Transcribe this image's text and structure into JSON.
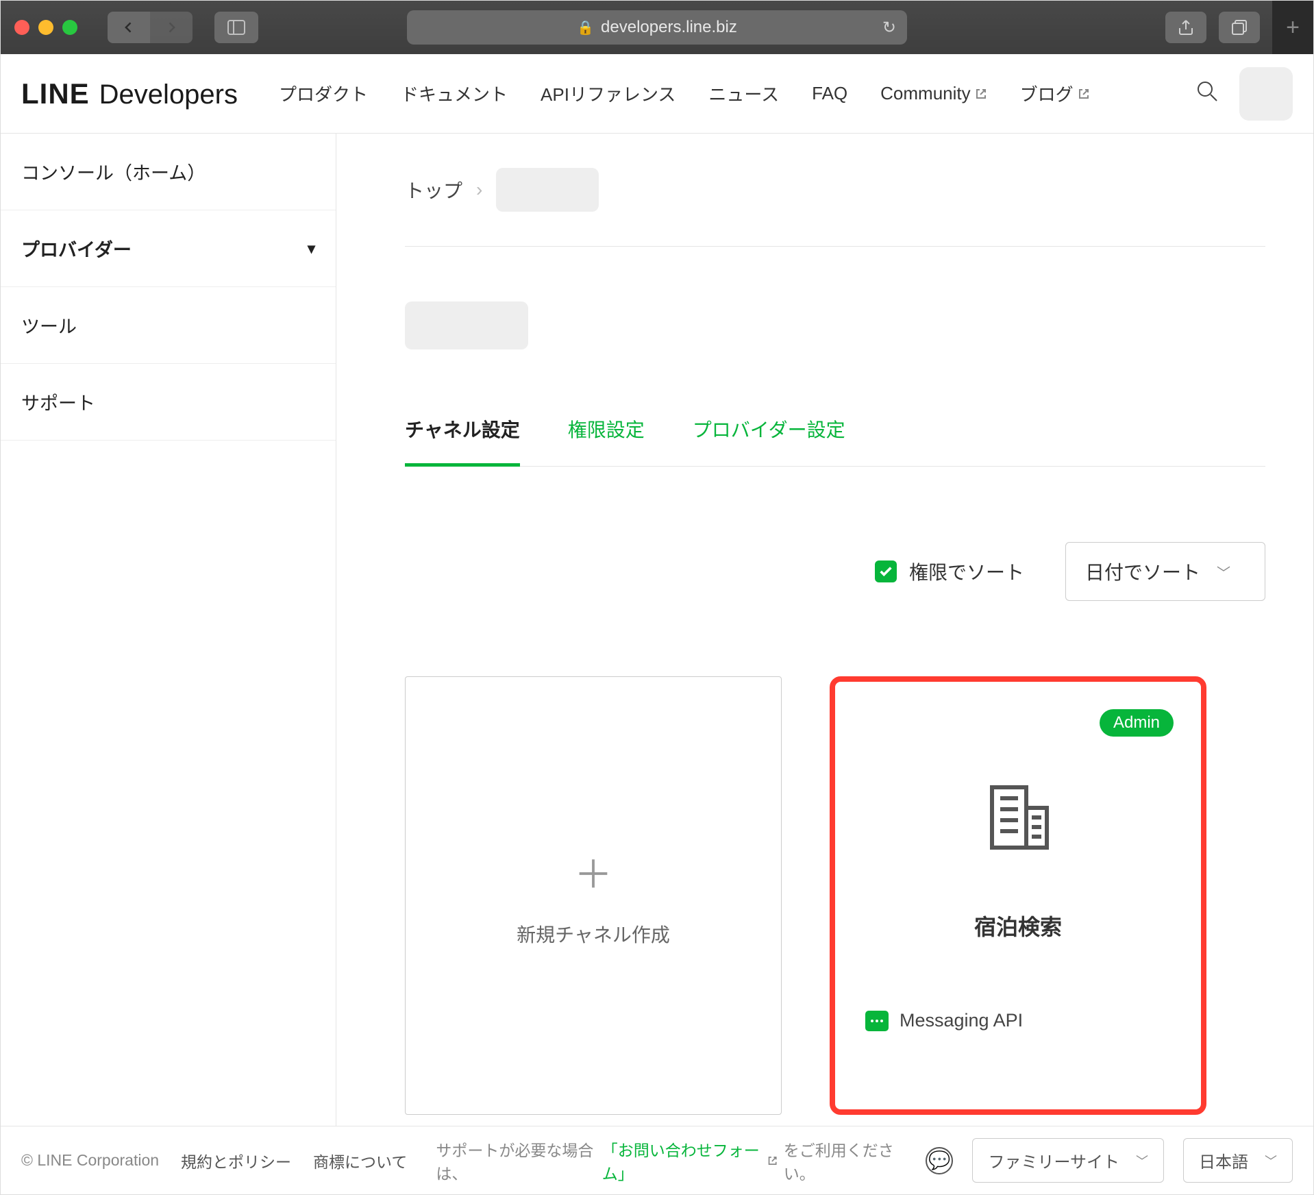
{
  "browser": {
    "url_host": "developers.line.biz"
  },
  "header": {
    "logo_line": "LINE",
    "logo_dev": "Developers",
    "nav": {
      "product": "プロダクト",
      "document": "ドキュメント",
      "api_ref": "APIリファレンス",
      "news": "ニュース",
      "faq": "FAQ",
      "community": "Community",
      "blog": "ブログ"
    }
  },
  "sidebar": {
    "console_home": "コンソール（ホーム）",
    "provider": "プロバイダー",
    "tools": "ツール",
    "support": "サポート"
  },
  "breadcrumb": {
    "top": "トップ"
  },
  "tabs": {
    "channel_settings": "チャネル設定",
    "role_settings": "権限設定",
    "provider_settings": "プロバイダー設定"
  },
  "controls": {
    "sort_by_role": "権限でソート",
    "sort_by_date": "日付でソート"
  },
  "cards": {
    "new_channel": "新規チャネル作成",
    "channel": {
      "badge": "Admin",
      "title": "宿泊検索",
      "type": "Messaging API"
    }
  },
  "footer": {
    "copyright": "© LINE Corporation",
    "policy": "規約とポリシー",
    "trademark": "商標について",
    "help_prefix": "サポートが必要な場合は、",
    "help_link": "「お問い合わせフォーム」",
    "help_suffix": "をご利用ください。",
    "family_site": "ファミリーサイト",
    "language": "日本語"
  }
}
